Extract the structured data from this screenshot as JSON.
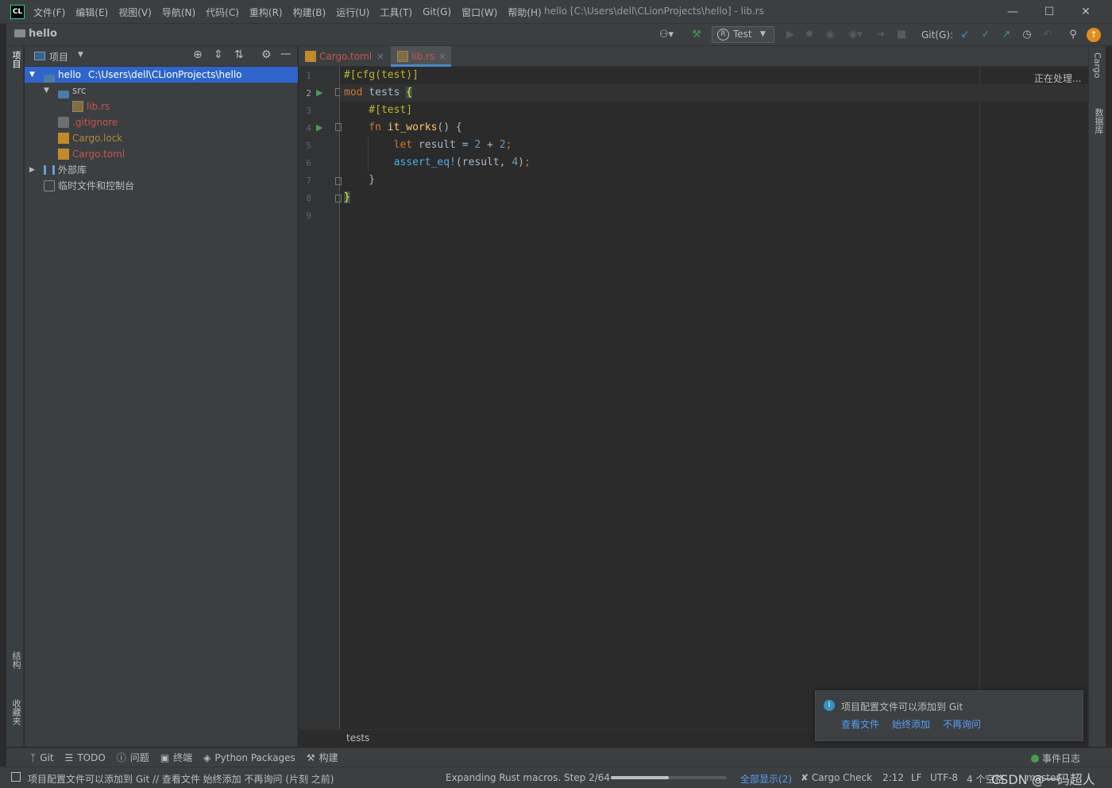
{
  "app": {
    "icon_label": "CL",
    "window_title": "hello [C:\\Users\\dell\\CLionProjects\\hello] - lib.rs",
    "menu": [
      "文件(F)",
      "编辑(E)",
      "视图(V)",
      "导航(N)",
      "代码(C)",
      "重构(R)",
      "构建(B)",
      "运行(U)",
      "工具(T)",
      "Git(G)",
      "窗口(W)",
      "帮助(H)"
    ]
  },
  "navbar": {
    "breadcrumb": "hello",
    "run_config": "Test",
    "git_label": "Git(G):"
  },
  "left_strip": {
    "project": "项目",
    "structure": "结构",
    "favorites": "收藏夹"
  },
  "right_strip": {
    "cargo": "Cargo",
    "database": "数据库"
  },
  "project_panel": {
    "title": "项目",
    "tree": [
      {
        "label": "hello",
        "path": "C:\\Users\\dell\\CLionProjects\\hello",
        "color": "#ffffff"
      },
      {
        "label": "src",
        "color": "#bbbbbb"
      },
      {
        "label": "lib.rs",
        "color": "#c75450"
      },
      {
        "label": ".gitignore",
        "color": "#c75450"
      },
      {
        "label": "Cargo.lock",
        "color": "#ae8a37"
      },
      {
        "label": "Cargo.toml",
        "color": "#c75450"
      },
      {
        "label": "外部库",
        "color": "#bbbbbb"
      },
      {
        "label": "临时文件和控制台",
        "color": "#bbbbbb"
      }
    ]
  },
  "tabs": [
    {
      "label": "Cargo.toml",
      "color": "#c75450"
    },
    {
      "label": "lib.rs",
      "color": "#c75450"
    }
  ],
  "editor": {
    "status": "正在处理...",
    "line_numbers": [
      "1",
      "2",
      "3",
      "4",
      "5",
      "6",
      "7",
      "8",
      "9"
    ],
    "breadcrumb": "tests"
  },
  "notification": {
    "message": "项目配置文件可以添加到 Git",
    "actions": [
      "查看文件",
      "始终添加",
      "不再询问"
    ]
  },
  "bottom_tools": [
    "Git",
    "TODO",
    "问题",
    "终端",
    "Python Packages",
    "构建"
  ],
  "bottom_right": "事件日志",
  "status": {
    "message": "项目配置文件可以添加到 Git // 查看文件   始终添加   不再询问 (片刻 之前)",
    "progress_text": "Expanding Rust macros. Step 2/64",
    "progress": 0.5,
    "show_all": "全部显示(2)",
    "cargo_check": "Cargo Check",
    "position": "2:12",
    "line_sep": "LF",
    "encoding": "UTF-8",
    "indent": "4 个空格",
    "branch": "master",
    "watermark": "CSDN @一码超人"
  },
  "colors": {
    "accent": "#2f65ca",
    "link": "#589df6",
    "run_green": "#499c54"
  }
}
